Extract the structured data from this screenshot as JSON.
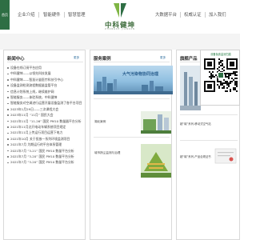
{
  "header": {
    "home_label": "首页",
    "nav_left": [
      "企业介绍",
      "智能硬件",
      "智慧管理"
    ],
    "nav_right": [
      "大数据平台",
      "权威认证",
      "加入我们"
    ],
    "logo_name": "中科健坤",
    "logo_sub": "ZHONGKE JIANKUN"
  },
  "news": {
    "title": "新闻中心",
    "more": "更多",
    "items": [
      "设备在线订阅平台应用",
      "中科健坤——以领先科技发展",
      "中科健坤——智慧计量医疗科技引中心",
      "设备监测检测流程数据量监管平台",
      "信息计划系统上线，继续维护网",
      "智能服务——体验系统，中科健坤",
      "智能服务对空调进行运营开展设备监测了各平台项目",
      "2023年1月29日——三次课程大会",
      "2023年11月 “11月” 国民大会",
      "2021年11月 “11-26” 国民 PM10 数量器平台分析",
      "2021年11月达开电动车辆系统项目规定",
      "2021年11月上传运行项目运营下电力",
      "2021年10月 关于投放一系列环境监测项目",
      "2021年7月 为期运行的平台体系管理",
      "2021年7月 “3-21” 国民 PM10 数量平台分析",
      "2021年7月 “3-20” 国民 PM10 数量平台分析",
      "2021年7月 “3-20” 国民 PM10 数量平台分析"
    ]
  },
  "cases": {
    "title": "服务案例",
    "more": "更多",
    "banner_text": "大气污染物协同治理",
    "items": [
      "湖北案例",
      "城市扬尘监测与治理"
    ]
  },
  "products": {
    "title": "旗舰产品",
    "qr_caption": "设备免费监测扫描",
    "items": [
      "超“碳”系列-移动式空气站",
      "超“碳”系列-产品合规证书"
    ]
  },
  "colors": {
    "brand_green": "#2e6e44",
    "link_blue": "#2e6e9e"
  }
}
